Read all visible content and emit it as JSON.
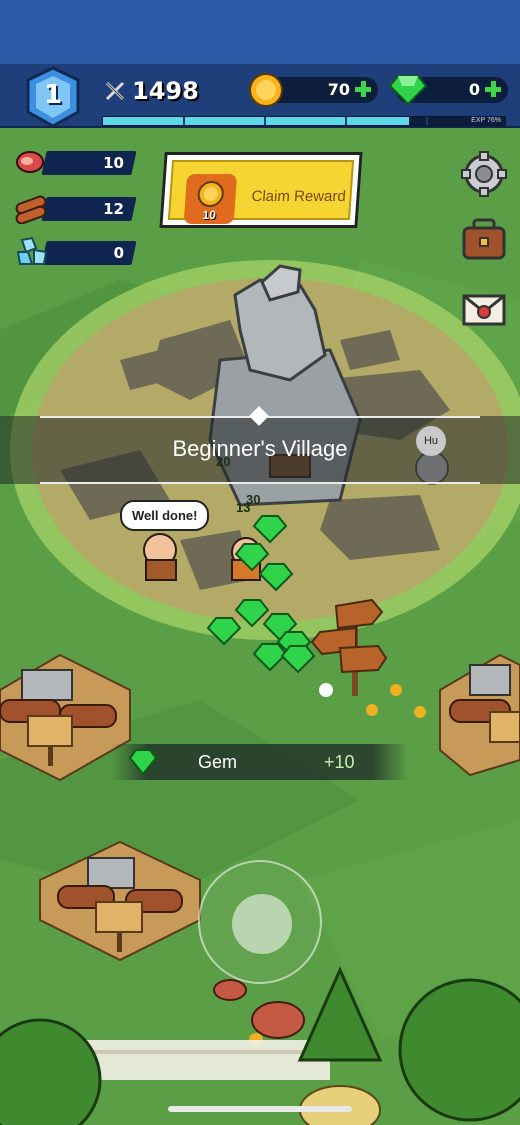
{
  "hud": {
    "level": "1",
    "power": "1498",
    "gold": "70",
    "gems": "0",
    "exp_label": "EXP 76%",
    "exp_progress": 0.76
  },
  "side_resources": [
    {
      "icon": "meat-icon",
      "value": "10"
    },
    {
      "icon": "wood-log-icon",
      "value": "12"
    },
    {
      "icon": "crystal-icon",
      "value": "0"
    }
  ],
  "claim_reward": {
    "label": "Claim Reward",
    "count": "10"
  },
  "right_menu": [
    {
      "icon": "settings-gear-icon"
    },
    {
      "icon": "inventory-bag-icon"
    },
    {
      "icon": "mail-envelope-icon"
    }
  ],
  "location_banner": {
    "title": "Beginner's Village"
  },
  "speech_bubble": {
    "text": "Well done!"
  },
  "npc": {
    "tag": "Hu"
  },
  "floating_numbers": [
    "20",
    "30",
    "13"
  ],
  "reward_toast": {
    "item": "Gem",
    "amount": "+10"
  },
  "colors": {
    "grass": "#5a9e45",
    "hud": "#1f3f7a",
    "exp_fill": "#5cd8e8",
    "gem_green": "#2fd44a",
    "claim_yellow": "#f6d432"
  }
}
